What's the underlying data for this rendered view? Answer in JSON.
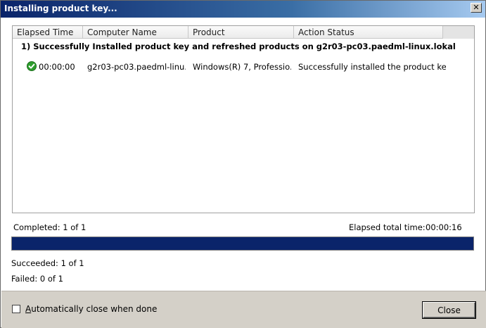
{
  "window": {
    "title": "Installing product key...",
    "close_glyph": "✕"
  },
  "listview": {
    "columns": [
      "Elapsed Time",
      "Computer Name",
      "Product",
      "Action Status"
    ],
    "group_title": "1) Successfully Installed  product key and refreshed products on g2r03-pc03.paedml-linux.lokal",
    "rows": [
      {
        "status_icon": "success-check-icon",
        "elapsed": "00:00:00",
        "computer": "g2r03-pc03.paedml-linu...",
        "product": "Windows(R) 7, Professio...",
        "action_status": "Successfully installed the product key."
      }
    ]
  },
  "summary": {
    "completed": "Completed: 1 of 1",
    "elapsed_label": "Elapsed total time:",
    "elapsed_value": "00:00:16",
    "progress_fraction": 1.0,
    "succeeded": "Succeeded: 1 of 1",
    "failed": "Failed: 0 of 1"
  },
  "footer": {
    "auto_close_prefix": "",
    "auto_close_accel": "A",
    "auto_close_rest": "utomatically close when done",
    "auto_close_checked": false,
    "close_button": "Close"
  },
  "colors": {
    "progress": "#0a246a",
    "success_icon": "#2e9e2e"
  }
}
